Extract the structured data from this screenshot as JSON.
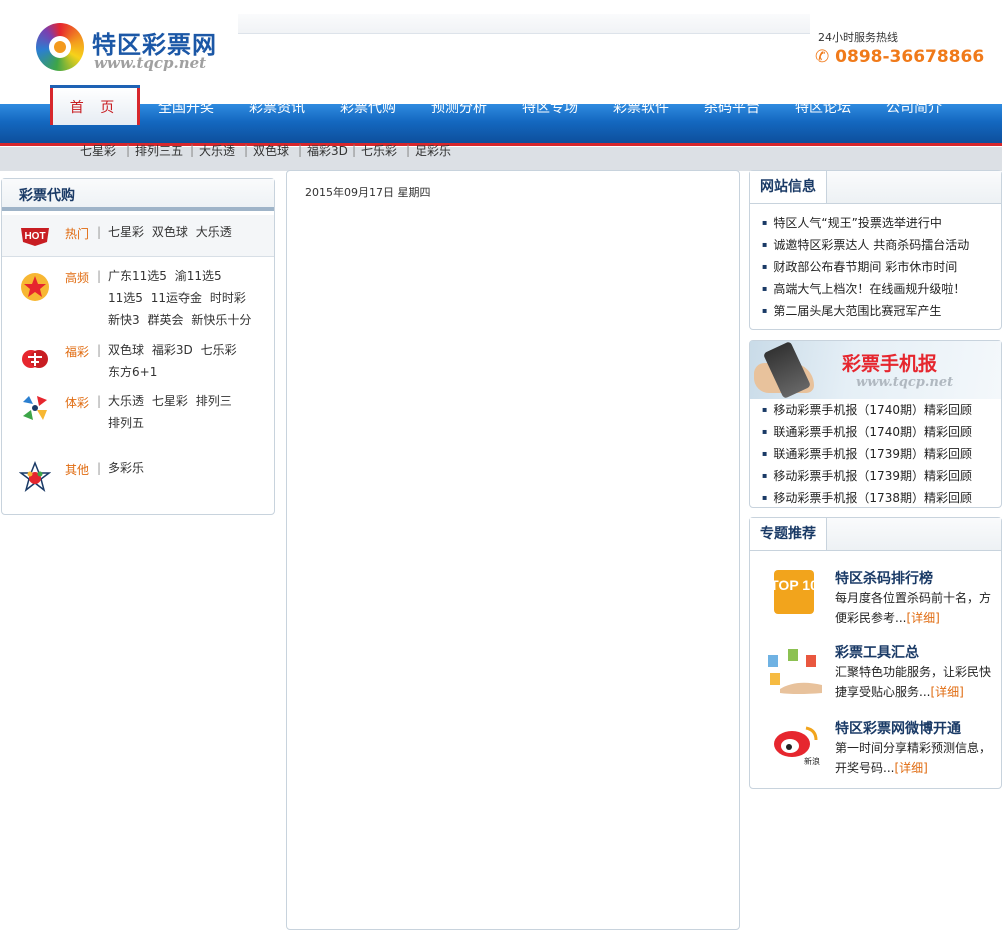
{
  "header": {
    "logo_name": "特区彩票网",
    "logo_url": "www.tqcp.net",
    "hotline_label": "24小时服务热线",
    "hotline_number": "✆ 0898-36678866"
  },
  "nav": {
    "items": [
      "首 页",
      "全国开奖",
      "彩票资讯",
      "彩票代购",
      "预测分析",
      "特区专场",
      "彩票软件",
      "杀码平台",
      "特区论坛",
      "公司简介"
    ]
  },
  "subnav": {
    "items": [
      "七星彩",
      "排列三五",
      "大乐透",
      "双色球",
      "福彩3D",
      "七乐彩",
      "足彩乐"
    ]
  },
  "lottery_buy": {
    "title": "彩票代购",
    "rows": [
      {
        "icon": "hot-icon",
        "category": "热门",
        "links": [
          "七星彩",
          "双色球",
          "大乐透"
        ]
      },
      {
        "icon": "high-frequency-star-icon",
        "category": "高频",
        "links": [
          "广东11选5",
          "渝11选5",
          "11选5",
          "11运夺金",
          "时时彩",
          "新快3",
          "群英会",
          "新快乐十分"
        ]
      },
      {
        "icon": "welfare-lottery-icon",
        "category": "福彩",
        "links": [
          "双色球",
          "福彩3D",
          "七乐彩",
          "东方6+1"
        ]
      },
      {
        "icon": "sports-lottery-icon",
        "category": "体彩",
        "links": [
          "大乐透",
          "七星彩",
          "排列三",
          "排列五"
        ]
      },
      {
        "icon": "other-lottery-icon",
        "category": "其他",
        "links": [
          "多彩乐"
        ]
      }
    ]
  },
  "center": {
    "date": "2015年09月17日 星期四"
  },
  "site_info": {
    "title": "网站信息",
    "items": [
      "特区人气“规王”投票选举进行中",
      "诚邀特区彩票达人 共商杀码擂台活动",
      "财政部公布春节期间 彩市休市时间",
      "高端大气上档次！在线画规升级啦！",
      "第二届头尾大范围比赛冠军产生"
    ]
  },
  "mobile_report": {
    "banner_title": "彩票手机报",
    "banner_url": "www.tqcp.net",
    "items": [
      "移动彩票手机报（1740期）精彩回顾",
      "联通彩票手机报（1740期）精彩回顾",
      "联通彩票手机报（1739期）精彩回顾",
      "移动彩票手机报（1739期）精彩回顾",
      "移动彩票手机报（1738期）精彩回顾"
    ]
  },
  "topics": {
    "title": "专题推荐",
    "items": [
      {
        "title": "特区杀码排行榜",
        "desc": "每月度各位置杀码前十名，方便彩民参考...",
        "more": "[详细]",
        "image_text": "TOP 10"
      },
      {
        "title": "彩票工具汇总",
        "desc": "汇聚特色功能服务，让彩民快捷享受贴心服务...",
        "more": "[详细]"
      },
      {
        "title": "特区彩票网微博开通",
        "desc": "第一时间分享精彩预测信息，开奖号码...",
        "more": "[详细]",
        "image_text": "新浪"
      }
    ]
  },
  "colors": {
    "nav_blue": "#1468c0",
    "accent_red": "#d7272c",
    "accent_orange": "#e06b10",
    "title_navy": "#1a3a66"
  }
}
